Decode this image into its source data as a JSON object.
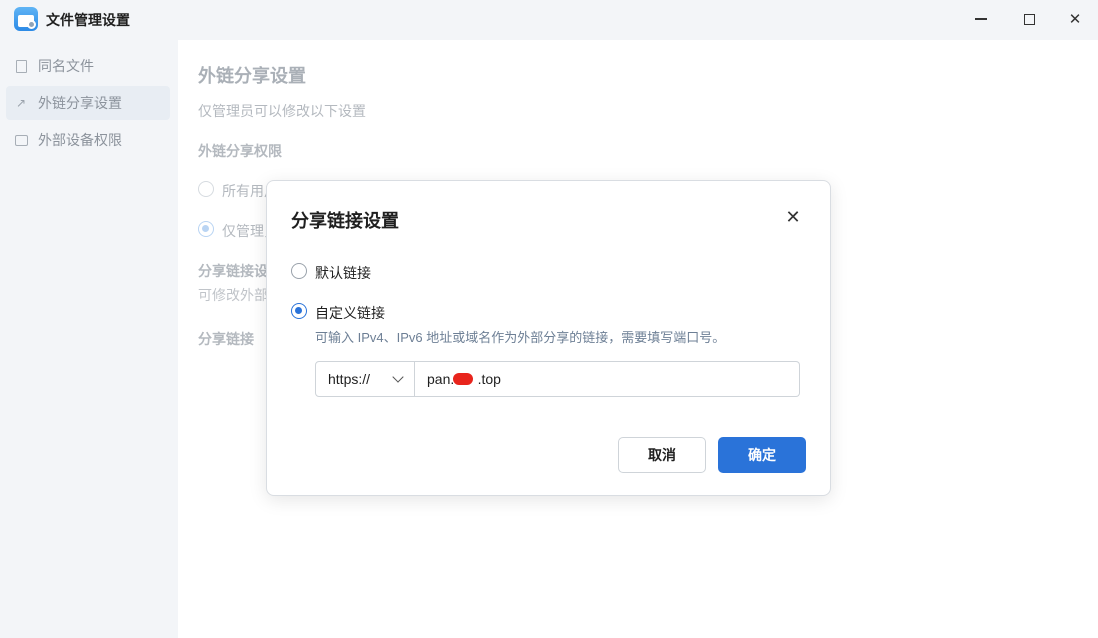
{
  "window": {
    "title": "文件管理设置",
    "minimize_icon": "minimize-icon",
    "maximize_icon": "maximize-icon",
    "close_icon": "close-icon"
  },
  "sidebar": {
    "items": [
      {
        "label": "同名文件",
        "icon": "file-icon",
        "active": false
      },
      {
        "label": "外链分享设置",
        "icon": "share-link-icon",
        "active": true
      },
      {
        "label": "外部设备权限",
        "icon": "drive-icon",
        "active": false
      }
    ]
  },
  "main": {
    "title": "外链分享设置",
    "subtitle": "仅管理员可以修改以下设置",
    "permission_heading": "外链分享权限",
    "options": [
      "所有用户",
      "仅管理员"
    ],
    "link_settings_heading": "分享链接设",
    "link_settings_desc": "可修改外部",
    "share_link_heading": "分享链接"
  },
  "dialog": {
    "title": "分享链接设置",
    "close_label": "✕",
    "option_default": "默认链接",
    "option_custom": "自定义链接",
    "selected": "自定义链接",
    "hint": "可输入 IPv4、IPv6 地址或域名作为外部分享的链接，需要填写端口号。",
    "protocol": "https://",
    "domain_value": "pan.      .top",
    "cancel_label": "取消",
    "ok_label": "确定"
  },
  "colors": {
    "accent": "#2a73d9",
    "redaction": "#e8241c"
  }
}
